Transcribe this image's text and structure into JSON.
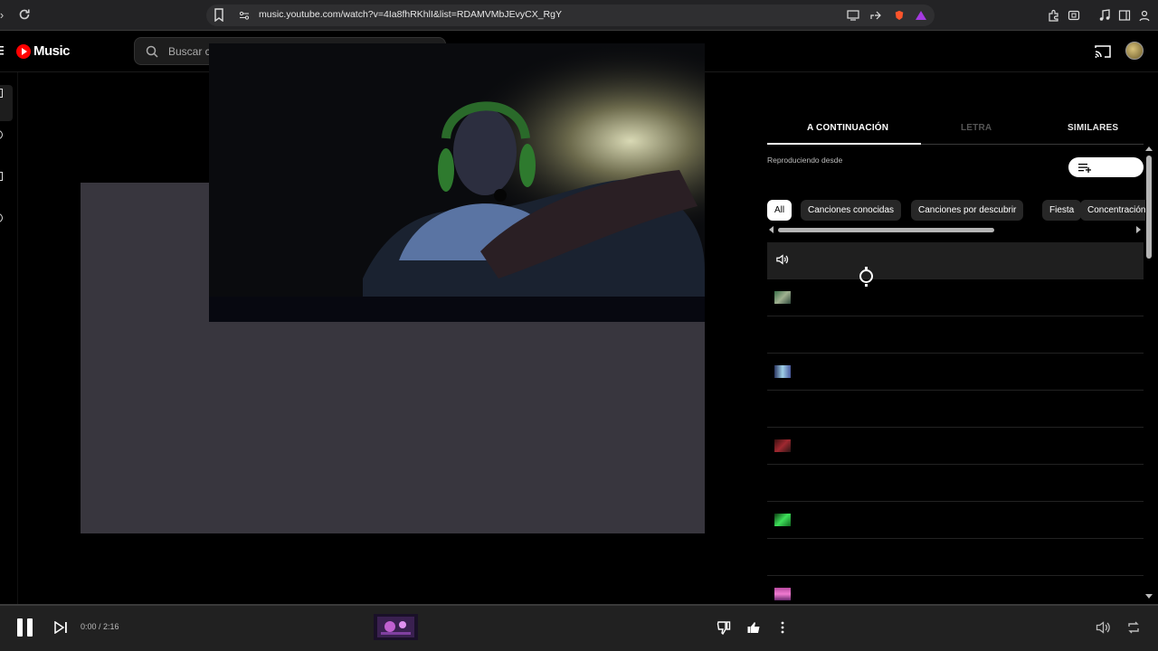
{
  "browser": {
    "url": "music.youtube.com/watch?v=4Ia8fhRKhlI&list=RDAMVMbJEvyCX_RgY"
  },
  "header": {
    "logo_text": "Music",
    "search_placeholder": "Buscar c"
  },
  "side_panel": {
    "tabs": [
      {
        "label": "A CONTINUACIÓN",
        "selected": true
      },
      {
        "label": "LETRA",
        "selected": false
      },
      {
        "label": "SIMILARES",
        "selected": false
      }
    ],
    "playing_from_label": "Reproduciendo desde",
    "chips": [
      {
        "label": "All",
        "selected": true
      },
      {
        "label": "Canciones conocidas",
        "selected": false
      },
      {
        "label": "Canciones por descubrir",
        "selected": false
      },
      {
        "label": "Fiesta",
        "selected": false
      },
      {
        "label": "Concentración",
        "selected": false
      }
    ],
    "queue_rows": 10
  },
  "player": {
    "time": "0:00 / 2:16",
    "progress_fraction": 0
  },
  "colors": {
    "accent": "#ff0000",
    "panel_bg": "#000000",
    "player_bar_bg": "#212121"
  }
}
